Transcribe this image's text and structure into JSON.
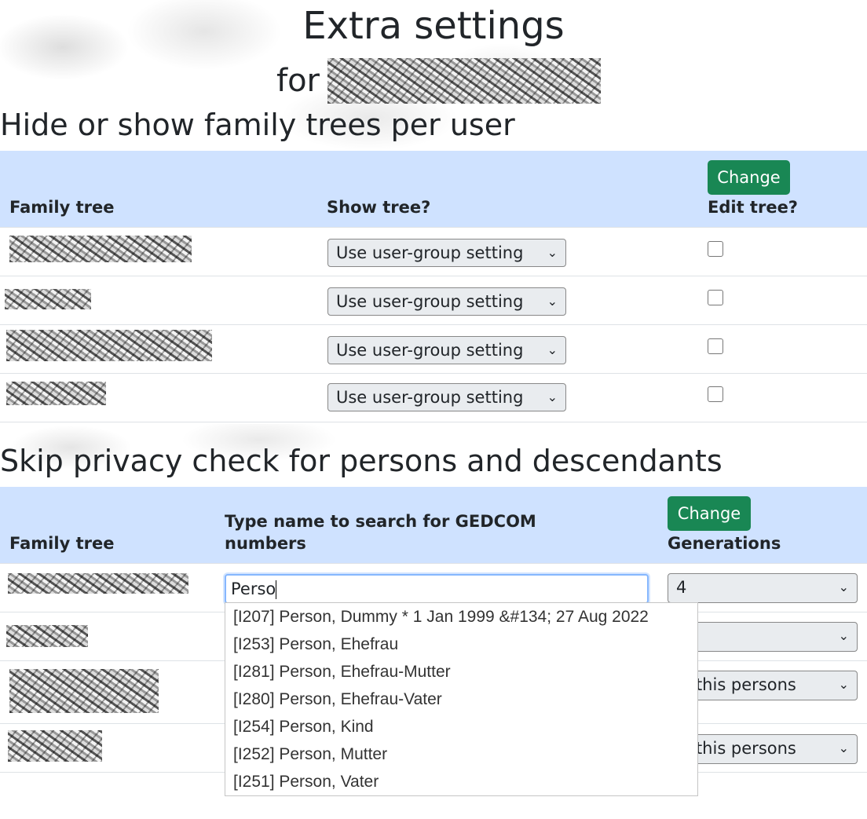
{
  "page": {
    "title": "Extra settings",
    "for_label": "for"
  },
  "section1": {
    "heading": "Hide or show family trees per user",
    "change_label": "Change",
    "columns": [
      "Family tree",
      "Show tree?",
      "Edit tree?"
    ],
    "rows": [
      {
        "show_tree": "Use user-group setting",
        "edit_tree": false
      },
      {
        "show_tree": "Use user-group setting",
        "edit_tree": false
      },
      {
        "show_tree": "Use user-group setting",
        "edit_tree": false
      },
      {
        "show_tree": "Use user-group setting",
        "edit_tree": false
      }
    ]
  },
  "section2": {
    "heading": "Skip privacy check for persons and descendants",
    "change_label": "Change",
    "columns": [
      "Family tree",
      "Type name to search for GEDCOM numbers",
      "Generations"
    ],
    "search_value": "Perso",
    "rows": [
      {
        "generations": "4"
      },
      {
        "generations": ""
      },
      {
        "generations": "ly this persons"
      },
      {
        "generations": "ly this persons"
      }
    ],
    "autocomplete": [
      "[I207] Person, Dummy * 1 Jan 1999 &#134; 27 Aug 2022",
      "[I253] Person, Ehefrau",
      "[I281] Person, Ehefrau-Mutter",
      "[I280] Person, Ehefrau-Vater",
      "[I254] Person, Kind",
      "[I252] Person, Mutter",
      "[I251] Person, Vater"
    ]
  },
  "icons": {
    "dropdown": "chevron-down-icon"
  },
  "colors": {
    "header_bg": "#cfe2ff",
    "button": "#198754",
    "focus": "#86b7fe"
  }
}
